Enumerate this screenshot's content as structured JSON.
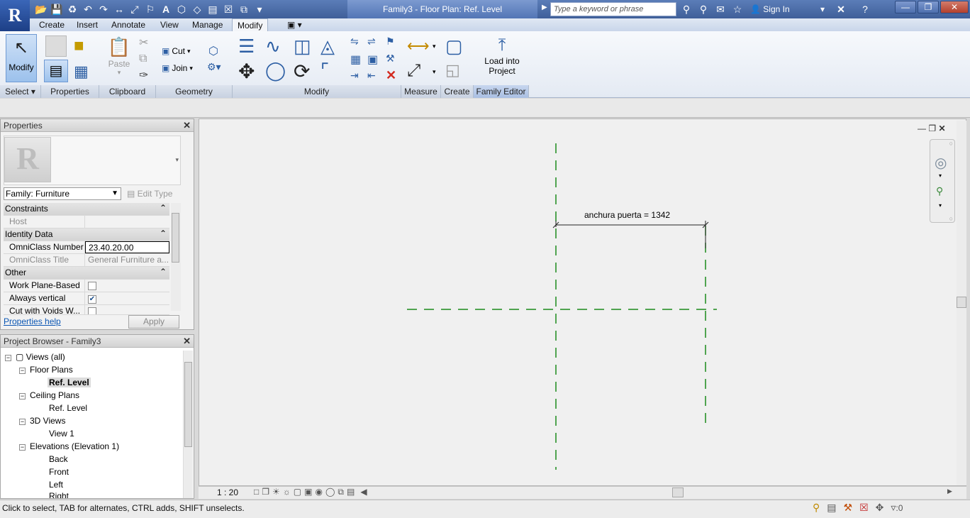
{
  "app": {
    "logo": "R",
    "window_title": "Family3 - Floor Plan: Ref. Level",
    "search_placeholder": "Type a keyword or phrase",
    "sign_in": "Sign In"
  },
  "ribbon": {
    "tabs": [
      "Create",
      "Insert",
      "Annotate",
      "View",
      "Manage",
      "Modify"
    ],
    "active_tab": "Modify",
    "buttons": {
      "modify": "Modify",
      "paste": "Paste",
      "cut": "Cut",
      "join": "Join",
      "load_into_project_line1": "Load into",
      "load_into_project_line2": "Project"
    },
    "panels": {
      "select": "Select",
      "properties": "Properties",
      "clipboard": "Clipboard",
      "geometry": "Geometry",
      "modify": "Modify",
      "measure": "Measure",
      "create": "Create",
      "family_editor": "Family Editor"
    }
  },
  "properties": {
    "title": "Properties",
    "family_selector": "Family: Furniture",
    "edit_type": "Edit Type",
    "groups": {
      "constraints": "Constraints",
      "identity": "Identity Data",
      "other": "Other"
    },
    "rows": {
      "host": "Host",
      "omniclass_number": "OmniClass Number",
      "omniclass_number_value": "23.40.20.00",
      "omniclass_title": "OmniClass Title",
      "omniclass_title_value": "General Furniture a...",
      "work_plane_based": "Work Plane-Based",
      "always_vertical": "Always vertical",
      "cut_with_voids": "Cut with Voids W..."
    },
    "checkboxes": {
      "work_plane_based": false,
      "always_vertical": true,
      "cut_with_voids": false
    },
    "help_link": "Properties help",
    "apply": "Apply"
  },
  "browser": {
    "title": "Project Browser - Family3",
    "tree": {
      "views_all": "Views (all)",
      "floor_plans": "Floor Plans",
      "fp_ref_level": "Ref. Level",
      "ceiling_plans": "Ceiling Plans",
      "cp_ref_level": "Ref. Level",
      "views_3d": "3D Views",
      "view_1": "View 1",
      "elevations": "Elevations (Elevation 1)",
      "back": "Back",
      "front": "Front",
      "left": "Left",
      "right": "Right"
    }
  },
  "canvas": {
    "dimension_label": "anchura puerta = 1342",
    "ref_plane_color": "#1a8a1a"
  },
  "view_control": {
    "scale": "1 : 20"
  },
  "status": {
    "message": "Click to select, TAB for alternates, CTRL adds, SHIFT unselects.",
    "filter_count": ":0"
  }
}
